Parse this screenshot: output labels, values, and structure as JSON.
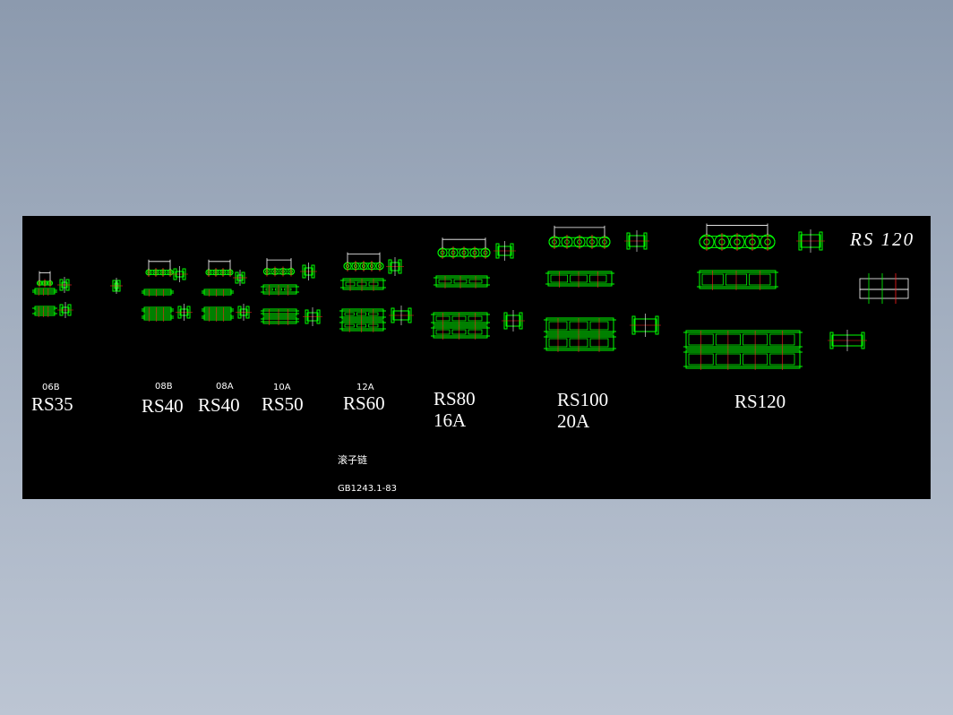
{
  "drawing": {
    "corner_title": "RS 120",
    "standard_name": "滚子链",
    "standard_code": "GB1243.1-83",
    "colors": {
      "background": "#000000",
      "outline": "#00ff00",
      "dimension": "#ffffff",
      "centerline": "#ff2020"
    },
    "groups": [
      {
        "code": "06B",
        "series": "RS35"
      },
      {
        "code": "08B",
        "series": "RS40"
      },
      {
        "code": "08A",
        "series": "RS40"
      },
      {
        "code": "10A",
        "series": "RS50"
      },
      {
        "code": "12A",
        "series": "RS60"
      },
      {
        "series": "RS80",
        "code": "16A"
      },
      {
        "series": "RS100",
        "code": "20A"
      },
      {
        "series": "RS120"
      }
    ]
  }
}
